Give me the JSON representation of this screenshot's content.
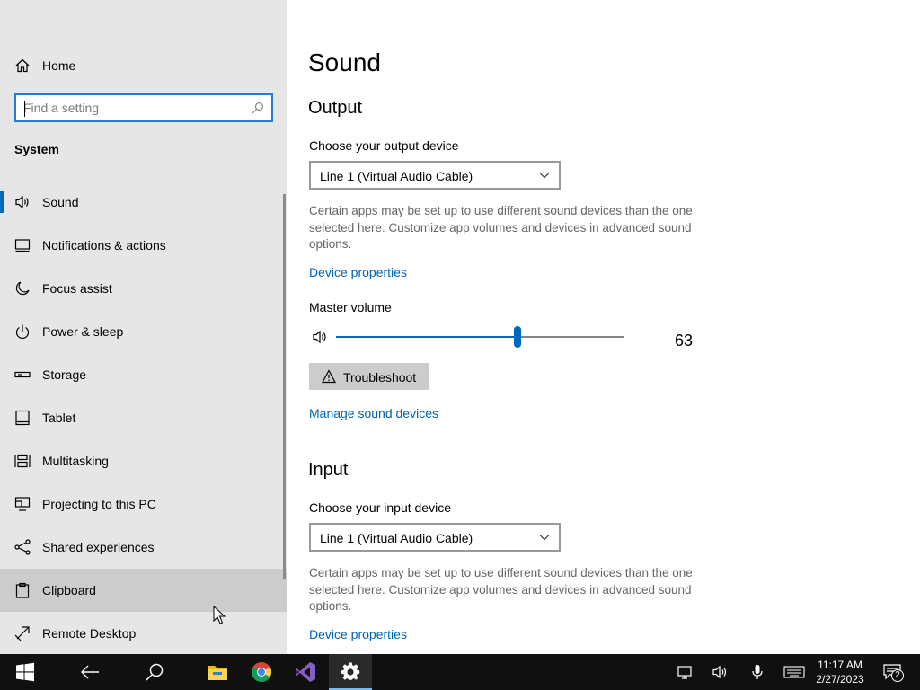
{
  "sidebar": {
    "home_label": "Home",
    "search_placeholder": "Find a setting",
    "section_title": "System",
    "items": [
      {
        "label": "Sound",
        "icon": "speaker-icon"
      },
      {
        "label": "Notifications & actions",
        "icon": "notification-icon"
      },
      {
        "label": "Focus assist",
        "icon": "moon-icon"
      },
      {
        "label": "Power & sleep",
        "icon": "power-icon"
      },
      {
        "label": "Storage",
        "icon": "storage-icon"
      },
      {
        "label": "Tablet",
        "icon": "tablet-icon"
      },
      {
        "label": "Multitasking",
        "icon": "multitasking-icon"
      },
      {
        "label": "Projecting to this PC",
        "icon": "projecting-icon"
      },
      {
        "label": "Shared experiences",
        "icon": "shared-icon"
      },
      {
        "label": "Clipboard",
        "icon": "clipboard-icon"
      },
      {
        "label": "Remote Desktop",
        "icon": "remote-desktop-icon"
      }
    ],
    "selected": "Sound",
    "hovered": "Clipboard"
  },
  "main": {
    "title": "Sound",
    "output": {
      "heading": "Output",
      "choose_label": "Choose your output device",
      "device": "Line 1 (Virtual Audio Cable)",
      "description": "Certain apps may be set up to use different sound devices than the one selected here. Customize app volumes and devices in advanced sound options.",
      "device_properties": "Device properties",
      "master_volume_label": "Master volume",
      "volume": "63",
      "troubleshoot": "Troubleshoot",
      "manage_devices": "Manage sound devices"
    },
    "input": {
      "heading": "Input",
      "choose_label": "Choose your input device",
      "device": "Line 1 (Virtual Audio Cable)",
      "description": "Certain apps may be set up to use different sound devices than the one selected here. Customize app volumes and devices in advanced sound options.",
      "device_properties": "Device properties"
    }
  },
  "taskbar": {
    "time": "11:17 AM",
    "date": "2/27/2023",
    "notification_count": "2",
    "apps": [
      "start-icon",
      "back-icon",
      "search-icon",
      "file-explorer-icon",
      "chrome-icon",
      "visual-studio-icon",
      "settings-icon"
    ],
    "active_app": "settings-icon"
  },
  "colors": {
    "accent": "#0067c0",
    "link": "#0063b1",
    "sidebar_bg": "#e6e6e6",
    "taskbar_bg": "#101010"
  }
}
